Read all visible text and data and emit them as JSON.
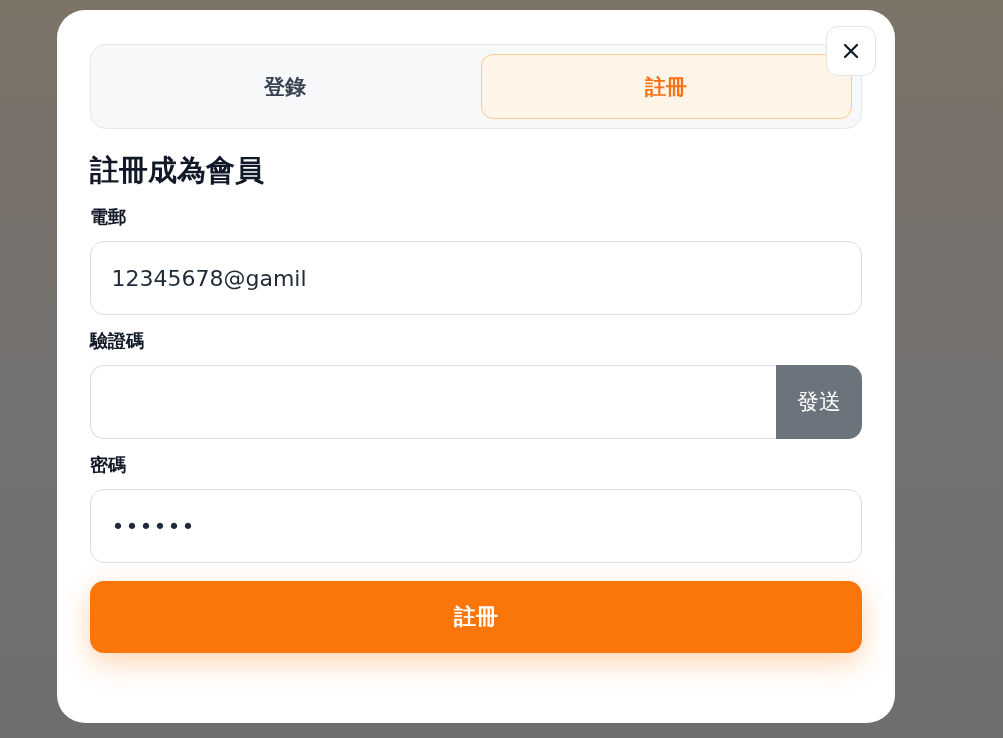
{
  "tabs": [
    {
      "label": "登錄",
      "selected": false
    },
    {
      "label": "註冊",
      "selected": true
    }
  ],
  "heading": "註冊成為會員",
  "fields": [
    {
      "label": "電郵",
      "kind": "text",
      "value": "12345678@gamil"
    },
    {
      "label": "驗證碼",
      "kind": "code",
      "button": "發送"
    },
    {
      "label": "密碼",
      "kind": "password",
      "value": "••••••"
    }
  ],
  "submit": "註冊"
}
